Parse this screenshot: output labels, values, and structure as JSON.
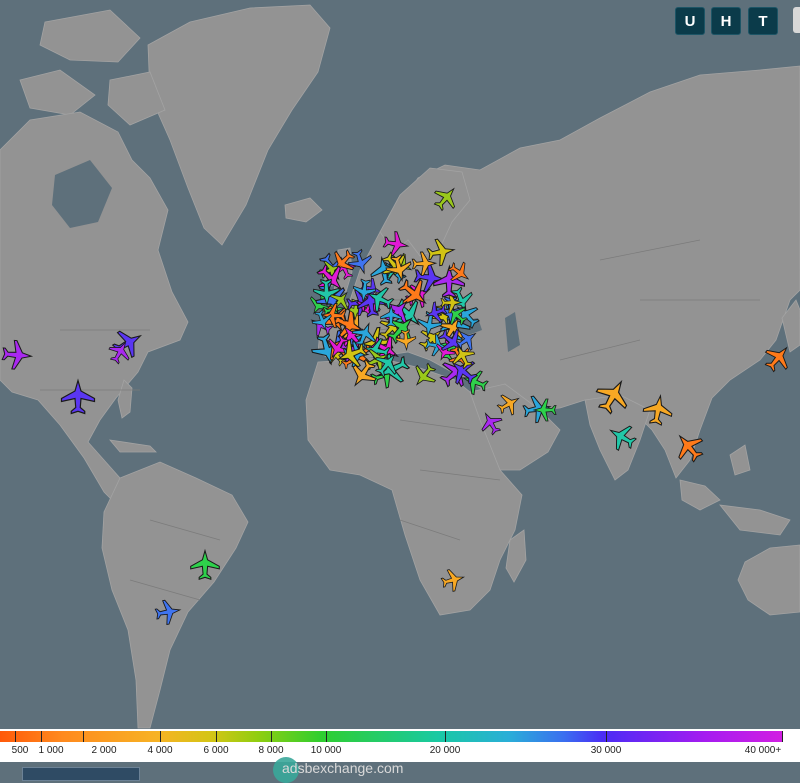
{
  "buttons": {
    "u": "U",
    "h": "H",
    "t": "T"
  },
  "legend": {
    "ticks": [
      "500",
      "1 000",
      "2 000",
      "4 000",
      "6 000",
      "8 000",
      "10 000",
      "20 000",
      "30 000",
      "40 000+"
    ]
  },
  "brand": "adsbexchange.com",
  "colors": {
    "water": "#5e707b",
    "land": "#939393",
    "legend_start": "#ff5a0a",
    "legend_end": "#d21fe2"
  },
  "aircraft_colors": [
    "#ff7a1a",
    "#f7a824",
    "#d2c414",
    "#9ac81b",
    "#2ed14b",
    "#22c7a8",
    "#2aa6db",
    "#3f74f0",
    "#5a36f2",
    "#a929f0",
    "#e21ad6"
  ]
}
